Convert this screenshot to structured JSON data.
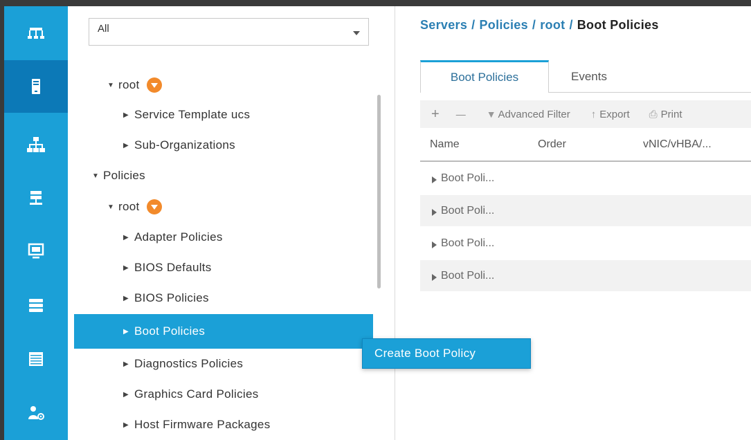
{
  "filter": {
    "value": "All"
  },
  "tree": [
    {
      "label": "root",
      "expanded": true,
      "org": true
    },
    {
      "label": "Service Template ucs",
      "expanded": false
    },
    {
      "label": "Sub-Organizations",
      "expanded": false
    },
    {
      "label": "Policies",
      "expanded": true
    },
    {
      "label": "root",
      "expanded": true,
      "org": true
    },
    {
      "label": "Adapter Policies",
      "expanded": false
    },
    {
      "label": "BIOS Defaults",
      "expanded": false
    },
    {
      "label": "BIOS Policies",
      "expanded": false
    },
    {
      "label": "Boot Policies",
      "expanded": false,
      "selected": true
    },
    {
      "label": "Diagnostics Policies",
      "expanded": false
    },
    {
      "label": "Graphics Card Policies",
      "expanded": false
    },
    {
      "label": "Host Firmware Packages",
      "expanded": false
    }
  ],
  "context_menu": {
    "item": "Create Boot Policy"
  },
  "breadcrumb": {
    "part1": "Servers",
    "part2": "Policies",
    "part3": "root",
    "current": "Boot Policies",
    "separator": "/"
  },
  "tabs": [
    {
      "label": "Boot Policies"
    },
    {
      "label": "Events"
    }
  ],
  "toolbar": {
    "add": "+",
    "remove": "—",
    "filter": "Advanced Filter",
    "export": "Export",
    "print": "Print"
  },
  "table": {
    "columns": [
      "Name",
      "Order",
      "vNIC/vHBA/..."
    ],
    "rows": [
      "Boot Poli...",
      "Boot Poli...",
      "Boot Poli...",
      "Boot Poli..."
    ]
  },
  "colors": {
    "accent": "#1ba0d7",
    "accent_dark": "#0c79b7",
    "org_badge": "#f28a2b",
    "breadcrumb": "#2b7fb3"
  },
  "rail_icons": [
    "network-topology-icon",
    "server-icon",
    "lan-icon",
    "san-icon",
    "vm-icon",
    "storage-icon",
    "chassis-icon",
    "admin-icon"
  ]
}
